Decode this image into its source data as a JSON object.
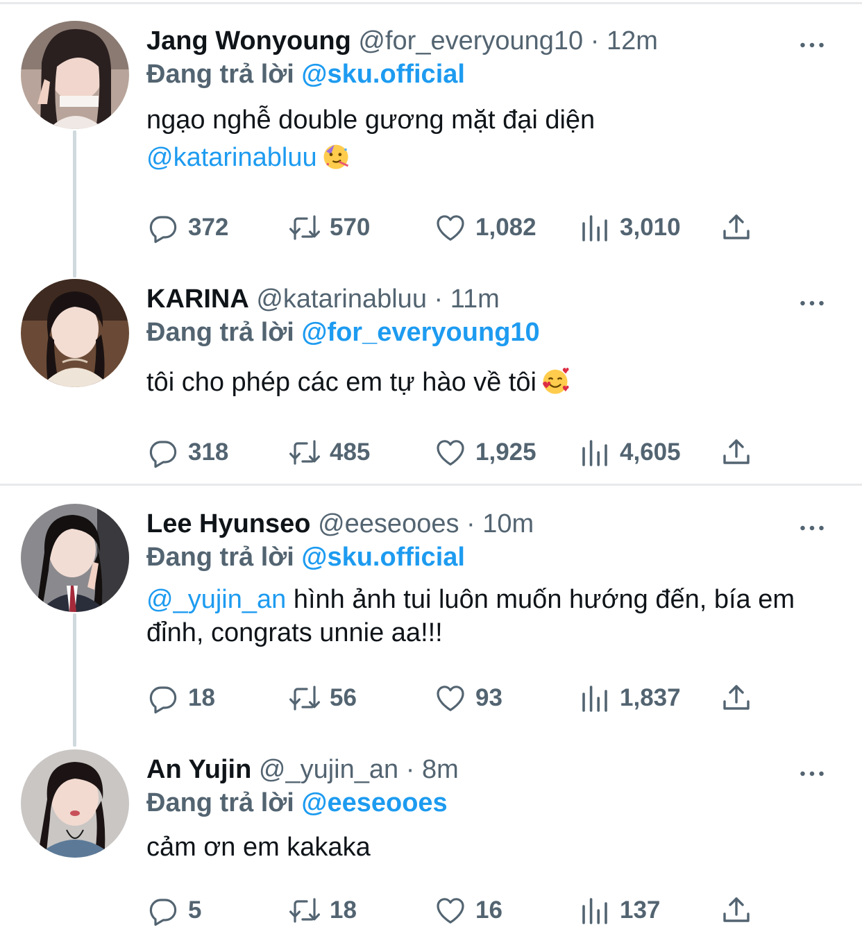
{
  "labels": {
    "replying_to": "Đang trả lời"
  },
  "colors": {
    "accent": "#1d9bf0",
    "secondary_text": "#536471",
    "primary_text": "#0f1419",
    "thread_line": "#cfd9de"
  },
  "tweets": [
    {
      "name": "Jang Wonyoung",
      "handle": "@for_everyoung10",
      "separator": "·",
      "time": "12m",
      "reply_to": "@sku.official",
      "text_parts": {
        "line1": "ngạo nghễ double gương mặt đại diện",
        "mention": "@katarinabluu",
        "emoji": "partying-face-emoji"
      },
      "counts": {
        "replies": "372",
        "retweets": "570",
        "likes": "1,082",
        "views": "3,010"
      }
    },
    {
      "name": "KARINA",
      "handle": "@katarinabluu",
      "separator": "·",
      "time": "11m",
      "reply_to": "@for_everyoung10",
      "text_parts": {
        "line1": "tôi cho phép các em tự hào về tôi",
        "emoji": "smiling-face-with-hearts-emoji"
      },
      "counts": {
        "replies": "318",
        "retweets": "485",
        "likes": "1,925",
        "views": "4,605"
      }
    },
    {
      "name": "Lee Hyunseo",
      "handle": "@eeseooes",
      "separator": "·",
      "time": "10m",
      "reply_to": "@sku.official",
      "text_parts": {
        "mention": "@_yujin_an",
        "rest": " hình ảnh tui luôn muốn hướng đến, bía em đỉnh, congrats unnie aa!!!"
      },
      "counts": {
        "replies": "18",
        "retweets": "56",
        "likes": "93",
        "views": "1,837"
      }
    },
    {
      "name": "An Yujin",
      "handle": "@_yujin_an",
      "separator": "·",
      "time": "8m",
      "reply_to": "@eeseooes",
      "text_parts": {
        "line1": "cảm ơn em kakaka"
      },
      "counts": {
        "replies": "5",
        "retweets": "18",
        "likes": "16",
        "views": "137"
      }
    }
  ]
}
